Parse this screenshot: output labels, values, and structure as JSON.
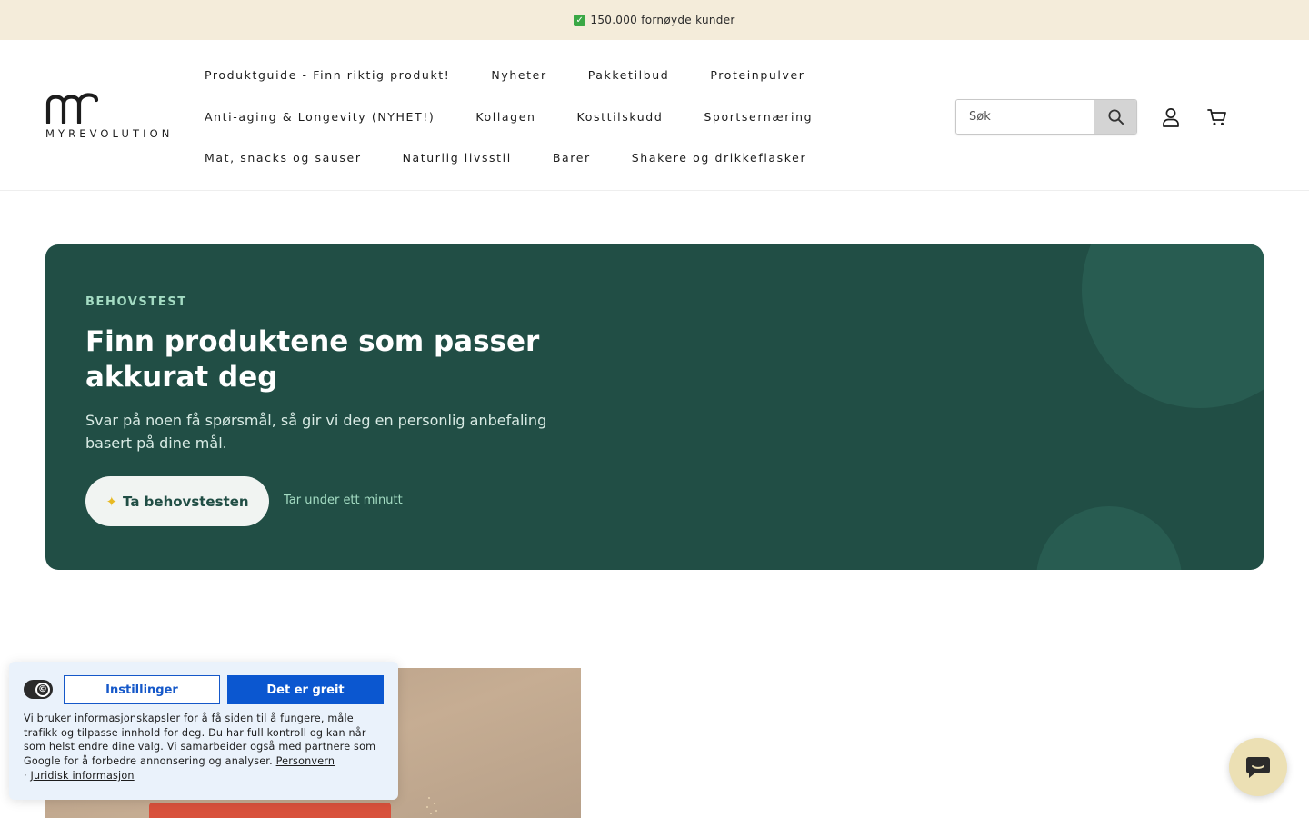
{
  "announcement": {
    "text": "150.000 fornøyde kunder"
  },
  "logo": {
    "wordmark": "MYREVOLUTION"
  },
  "nav": {
    "rows": [
      [
        "Produktguide - Finn riktig produkt!",
        "Nyheter",
        "Pakketilbud",
        "Proteinpulver"
      ],
      [
        "Anti-aging & Longevity (NYHET!)",
        "Kollagen",
        "Kosttilskudd",
        "Sportsernæring"
      ],
      [
        "Mat, snacks og sauser",
        "Naturlig livsstil",
        "Barer",
        "Shakere og drikkeflasker"
      ]
    ]
  },
  "search": {
    "placeholder": "Søk"
  },
  "icons": {
    "search": "search-icon",
    "account": "user-icon",
    "cart": "cart-icon",
    "chat": "chat-icon",
    "cookie": "cookie-icon"
  },
  "hero": {
    "eyebrow": "BEHOVSTEST",
    "title": "Finn produktene som passer akkurat deg",
    "subtitle": "Svar på noen få spørsmål, så gir vi deg en personlig anbefaling basert på dine mål.",
    "cta_label": "Ta behovstesten",
    "note": "Tar under ett minutt"
  },
  "cookie": {
    "settings_label": "Instillinger",
    "accept_label": "Det er greit",
    "text": "Vi bruker informasjonskapsler for å få siden til å fungere, måle trafikk og tilpasse innhold for deg. Du har full kontroll og kan når som helst endre dine valg. Vi samarbeider også med partnere som Google for å forbedre annonsering og analyser.",
    "privacy_link": "Personvern",
    "legal_link": "Juridisk informasjon"
  },
  "colors": {
    "hero_bg": "#214e45",
    "announcement_bg": "#f4ecda",
    "accept_button": "#0b57d0",
    "chat_button": "#ece0b4"
  }
}
